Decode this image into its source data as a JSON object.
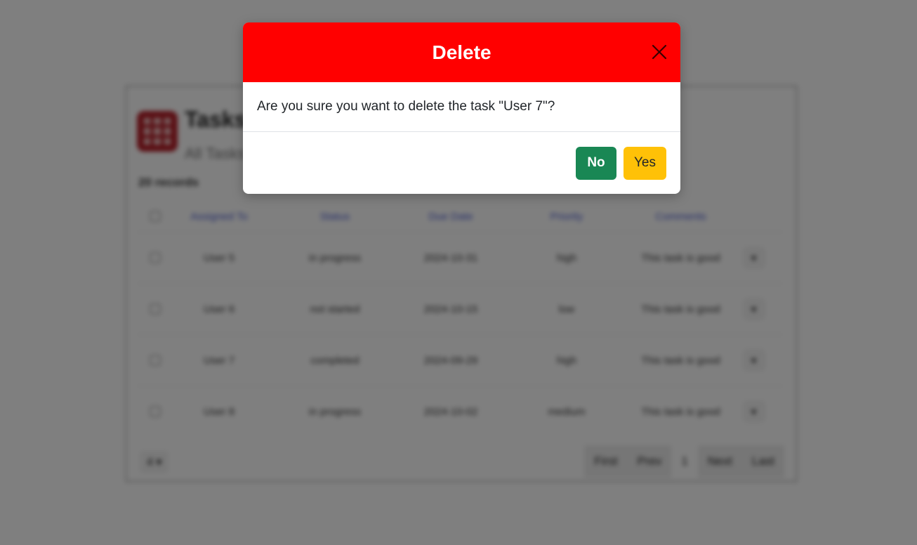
{
  "modal": {
    "title": "Delete",
    "message": "Are you sure you want to delete the task \"User 7\"?",
    "no_label": "No",
    "yes_label": "Yes",
    "header_color": "#ff0000",
    "no_color": "#198754",
    "yes_color": "#ffc107",
    "close_icon": "close-icon"
  },
  "background": {
    "title": "Tasks",
    "subtitle": "All Tasks",
    "records": "20 records",
    "columns": [
      "Assigned To",
      "Status",
      "Due Date",
      "Priority",
      "Comments"
    ],
    "rows": [
      {
        "assigned": "User 5",
        "status": "in progress",
        "due": "2024-10-31",
        "priority": "high",
        "comments": "This task is good"
      },
      {
        "assigned": "User 6",
        "status": "not started",
        "due": "2024-10-15",
        "priority": "low",
        "comments": "This task is good"
      },
      {
        "assigned": "User 7",
        "status": "completed",
        "due": "2024-09-29",
        "priority": "high",
        "comments": "This task is good"
      },
      {
        "assigned": "User 8",
        "status": "in progress",
        "due": "2024-10-02",
        "priority": "medium",
        "comments": "This task is good"
      }
    ],
    "page_size": "4",
    "pager": {
      "first": "First",
      "prev": "Prev",
      "current": "1",
      "next": "Next",
      "last": "Last"
    }
  }
}
